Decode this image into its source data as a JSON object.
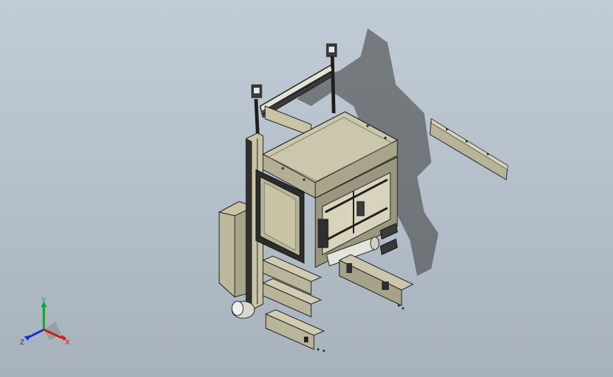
{
  "viewport": {
    "background_top": "#c2ccd6",
    "background_bottom": "#a7b2bc"
  },
  "model": {
    "body_color": "#c9c4a6",
    "frame_color": "#2f2f2f",
    "shadow_color": "#3a3a3a",
    "metal_color": "#d8d8d0"
  },
  "triad": {
    "x_label": "X",
    "y_label": "Y",
    "z_label": "Z",
    "x_color": "#d01818",
    "y_color": "#10a030",
    "z_color": "#1830d0"
  }
}
